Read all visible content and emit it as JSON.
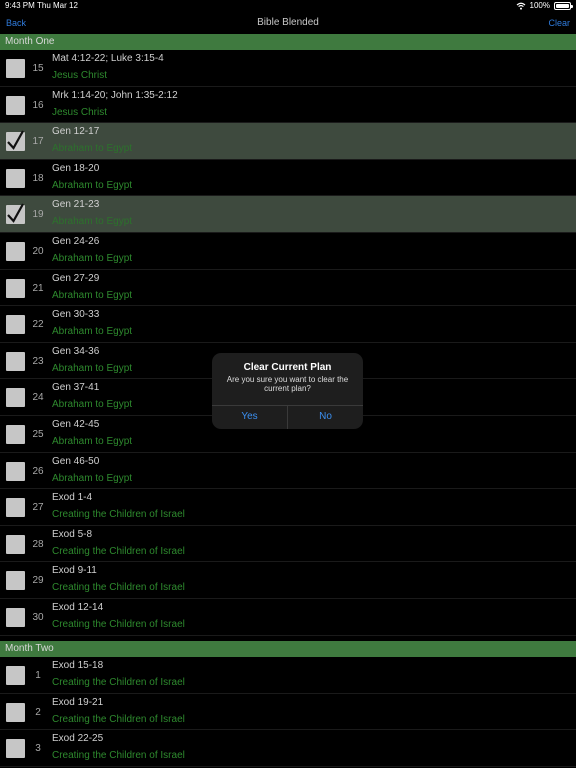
{
  "status": {
    "time": "9:43 PM",
    "date": "Thu Mar 12",
    "battery": "100%",
    "battery_level": 1.0
  },
  "nav": {
    "back_label": "Back",
    "title": "Bible Blended",
    "clear_label": "Clear"
  },
  "sections": [
    {
      "title": "Month One",
      "days": [
        {
          "day": "15",
          "reading": "Mat 4:12-22; Luke 3:15-4",
          "theme": "Jesus Christ",
          "checked": false
        },
        {
          "day": "16",
          "reading": "Mrk 1:14-20; John 1:35-2:12",
          "theme": "Jesus Christ",
          "checked": false
        },
        {
          "day": "17",
          "reading": "Gen 12-17",
          "theme": "Abraham to Egypt",
          "checked": true
        },
        {
          "day": "18",
          "reading": "Gen 18-20",
          "theme": "Abraham to Egypt",
          "checked": false
        },
        {
          "day": "19",
          "reading": "Gen 21-23",
          "theme": "Abraham to Egypt",
          "checked": true
        },
        {
          "day": "20",
          "reading": "Gen 24-26",
          "theme": "Abraham to Egypt",
          "checked": false
        },
        {
          "day": "21",
          "reading": "Gen 27-29",
          "theme": "Abraham to Egypt",
          "checked": false
        },
        {
          "day": "22",
          "reading": "Gen 30-33",
          "theme": "Abraham to Egypt",
          "checked": false
        },
        {
          "day": "23",
          "reading": "Gen 34-36",
          "theme": "Abraham to Egypt",
          "checked": false
        },
        {
          "day": "24",
          "reading": "Gen 37-41",
          "theme": "Abraham to Egypt",
          "checked": false
        },
        {
          "day": "25",
          "reading": "Gen 42-45",
          "theme": "Abraham to Egypt",
          "checked": false
        },
        {
          "day": "26",
          "reading": "Gen 46-50",
          "theme": "Abraham to Egypt",
          "checked": false
        },
        {
          "day": "27",
          "reading": "Exod 1-4",
          "theme": "Creating the Children of Israel",
          "checked": false
        },
        {
          "day": "28",
          "reading": "Exod 5-8",
          "theme": "Creating the Children of Israel",
          "checked": false
        },
        {
          "day": "29",
          "reading": "Exod 9-11",
          "theme": "Creating the Children of Israel",
          "checked": false
        },
        {
          "day": "30",
          "reading": "Exod 12-14",
          "theme": "Creating the Children of Israel",
          "checked": false
        }
      ]
    },
    {
      "title": "Month Two",
      "days": [
        {
          "day": "1",
          "reading": "Exod 15-18",
          "theme": "Creating the Children of Israel",
          "checked": false
        },
        {
          "day": "2",
          "reading": "Exod 19-21",
          "theme": "Creating the Children of Israel",
          "checked": false
        },
        {
          "day": "3",
          "reading": "Exod 22-25",
          "theme": "Creating the Children of Israel",
          "checked": false
        }
      ]
    }
  ],
  "dialog": {
    "title": "Clear Current Plan",
    "message": "Are you sure you want to clear the current plan?",
    "yes_label": "Yes",
    "no_label": "No"
  },
  "colors": {
    "section_header": "#3f7a3f",
    "theme_text": "#2e8a2e",
    "accent": "#2f7bdc",
    "checked_row": "#3e4a3e"
  }
}
